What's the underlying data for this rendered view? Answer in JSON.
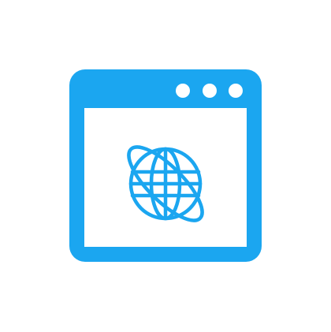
{
  "icon": {
    "name": "browser-window-globe-icon",
    "accent_color": "#1BA6F0",
    "background_color": "#FFFFFF",
    "window_dots": 3
  }
}
